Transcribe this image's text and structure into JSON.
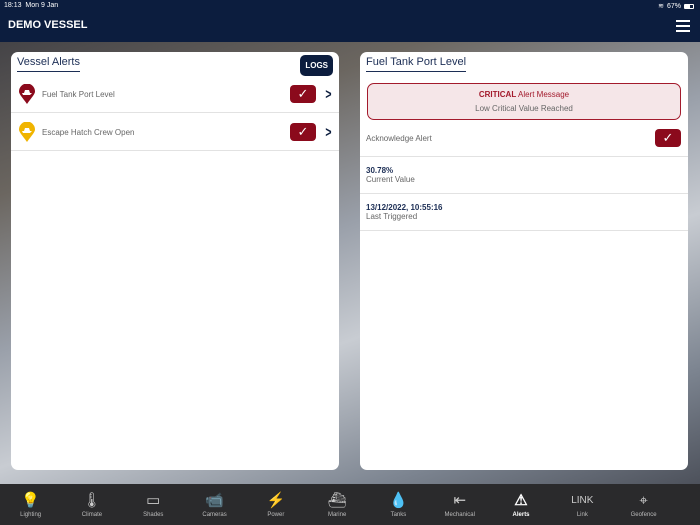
{
  "status": {
    "time": "18:13",
    "date": "Mon 9 Jan",
    "battery": "67%"
  },
  "header": {
    "title": "DEMO VESSEL"
  },
  "alerts_panel": {
    "title": "Vessel Alerts",
    "logs_label": "LOGS",
    "items": [
      {
        "label": "Fuel Tank Port Level",
        "color": "#8b0a1c"
      },
      {
        "label": "Escape Hatch Crew Open",
        "color": "#f0b400"
      }
    ]
  },
  "detail": {
    "title": "Fuel Tank Port Level",
    "critical_word": "CRITICAL",
    "critical_rest": " Alert Message",
    "critical_sub": "Low Critical Value Reached",
    "ack_label": "Acknowledge Alert",
    "current_value": "30.78%",
    "current_label": "Current Value",
    "triggered_value": "13/12/2022, 10:55:16",
    "triggered_label": "Last Triggered"
  },
  "tabs": [
    {
      "label": "Lighting",
      "icon": "bulb-icon",
      "glyph": "💡"
    },
    {
      "label": "Climate",
      "icon": "thermometer-icon",
      "glyph": "🌡"
    },
    {
      "label": "Shades",
      "icon": "shades-icon",
      "glyph": "▭"
    },
    {
      "label": "Cameras",
      "icon": "camera-icon",
      "glyph": "📹"
    },
    {
      "label": "Power",
      "icon": "battery-icon",
      "glyph": "⚡"
    },
    {
      "label": "Marine",
      "icon": "boat-icon",
      "glyph": "⛴"
    },
    {
      "label": "Tanks",
      "icon": "tank-icon",
      "glyph": "💧"
    },
    {
      "label": "Mechanical",
      "icon": "door-icon",
      "glyph": "⇤"
    },
    {
      "label": "Alerts",
      "icon": "warning-icon",
      "glyph": "⚠"
    },
    {
      "label": "Link",
      "icon": "link-icon",
      "glyph": "LINK"
    },
    {
      "label": "Geofence",
      "icon": "geofence-icon",
      "glyph": "⌖"
    }
  ]
}
